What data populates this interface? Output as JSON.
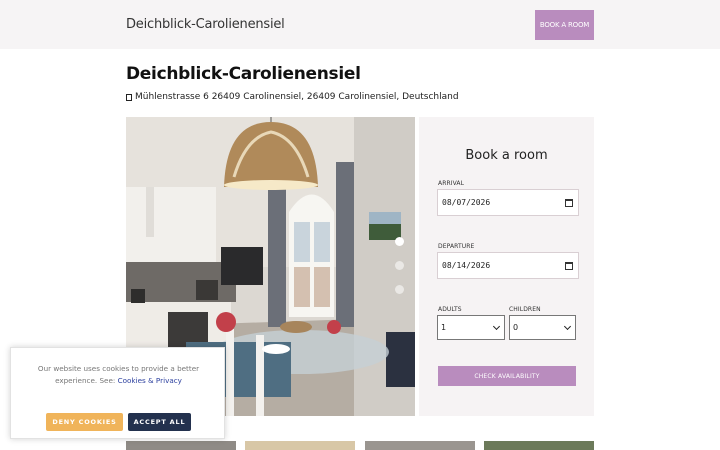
{
  "header": {
    "brand": "Deichblick-Carolienensiel",
    "book_button": "BOOK A ROOM"
  },
  "property": {
    "title": "Deichblick-Carolienensiel",
    "address": "Mühlenstrasse 6 26409 Carolinensiel, 26409 Carolinensiel, Deutschland"
  },
  "gallery": {
    "slide_count": 3,
    "active_slide": 1
  },
  "booking": {
    "title": "Book a room",
    "arrival_label": "ARRIVAL",
    "arrival_value": "08/07/2026",
    "departure_label": "DEPARTURE",
    "departure_value": "08/14/2026",
    "adults_label": "ADULTS",
    "adults_value": "1",
    "children_label": "CHILDREN",
    "children_value": "0",
    "check_button": "CHECK AVAILABILITY"
  },
  "cookie": {
    "text": "Our website uses cookies to provide a better experience. See:",
    "link": "Cookies & Privacy",
    "deny_button": "DENY COOKIES",
    "accept_button": "ACCEPT ALL"
  },
  "colors": {
    "accent": "#b98cbe",
    "deny": "#f0b45a",
    "accept": "#23314e"
  }
}
